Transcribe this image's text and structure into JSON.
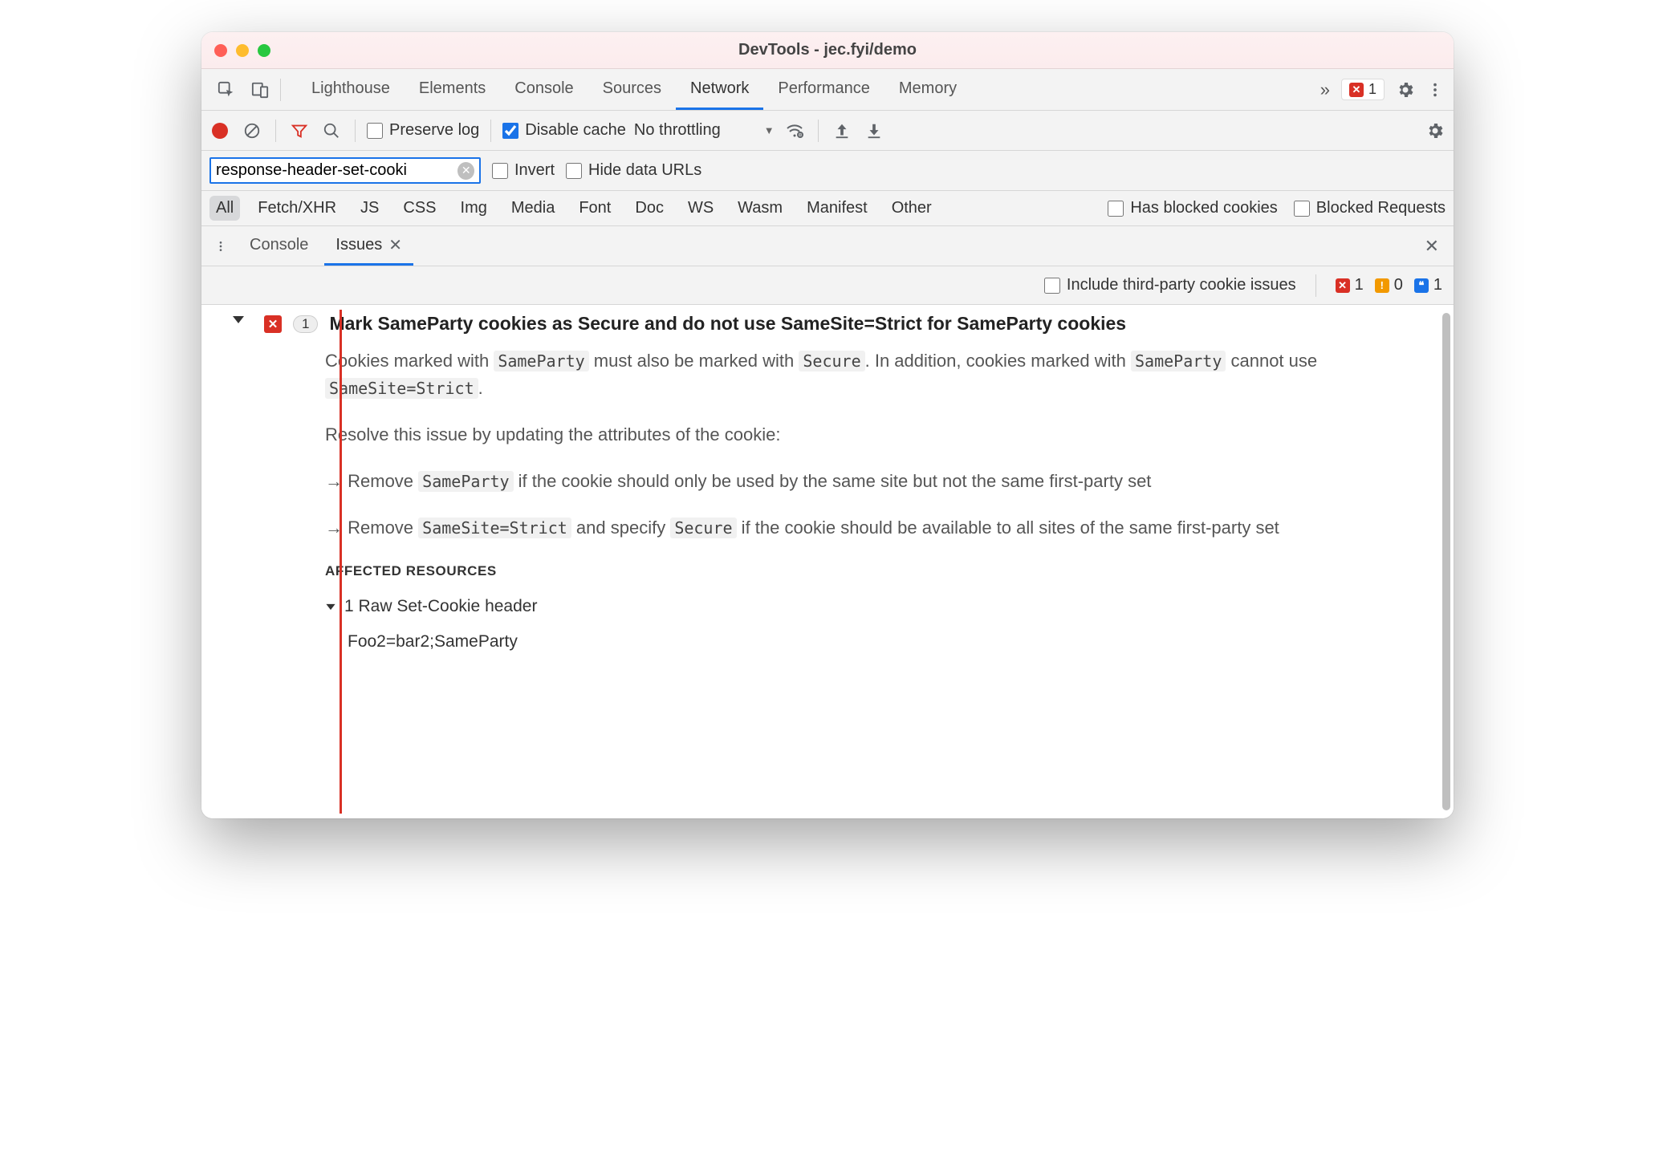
{
  "titlebar": {
    "title": "DevTools - jec.fyi/demo"
  },
  "main_tabs": {
    "items": [
      "Lighthouse",
      "Elements",
      "Console",
      "Sources",
      "Network",
      "Performance",
      "Memory"
    ],
    "active": "Network",
    "error_count": "1"
  },
  "network_toolbar": {
    "preserve_log_label": "Preserve log",
    "preserve_log_checked": false,
    "disable_cache_label": "Disable cache",
    "disable_cache_checked": true,
    "throttling_label": "No throttling"
  },
  "filter_row": {
    "filter_value": "response-header-set-cooki",
    "invert_label": "Invert",
    "hide_data_urls_label": "Hide data URLs"
  },
  "type_filters": {
    "items": [
      "All",
      "Fetch/XHR",
      "JS",
      "CSS",
      "Img",
      "Media",
      "Font",
      "Doc",
      "WS",
      "Wasm",
      "Manifest",
      "Other"
    ],
    "active": "All",
    "has_blocked_label": "Has blocked cookies",
    "blocked_requests_label": "Blocked Requests"
  },
  "drawer_tabs": {
    "items": [
      "Console",
      "Issues"
    ],
    "active": "Issues"
  },
  "issues_bar": {
    "include_third_party_label": "Include third-party cookie issues",
    "counts": {
      "error": "1",
      "warn": "0",
      "info": "1"
    }
  },
  "issue": {
    "count_badge": "1",
    "headline": "Mark SameParty cookies as Secure and do not use SameSite=Strict for SameParty cookies",
    "p1a": "Cookies marked with ",
    "p1b": " must also be marked with ",
    "p1c": ". In addition, cookies marked with ",
    "p1d": " cannot use ",
    "p1e": ".",
    "code_sameparty": "SameParty",
    "code_secure": "Secure",
    "code_strict": "SameSite=Strict",
    "p2": "Resolve this issue by updating the attributes of the cookie:",
    "b1a": "Remove ",
    "b1b": " if the cookie should only be used by the same site but not the same first-party set",
    "b2a": "Remove ",
    "b2b": " and specify ",
    "b2c": " if the cookie should be available to all sites of the same first-party set",
    "affected_heading": "AFFECTED RESOURCES",
    "resource_row": "1 Raw Set-Cookie header",
    "resource_value": "Foo2=bar2;SameParty"
  }
}
